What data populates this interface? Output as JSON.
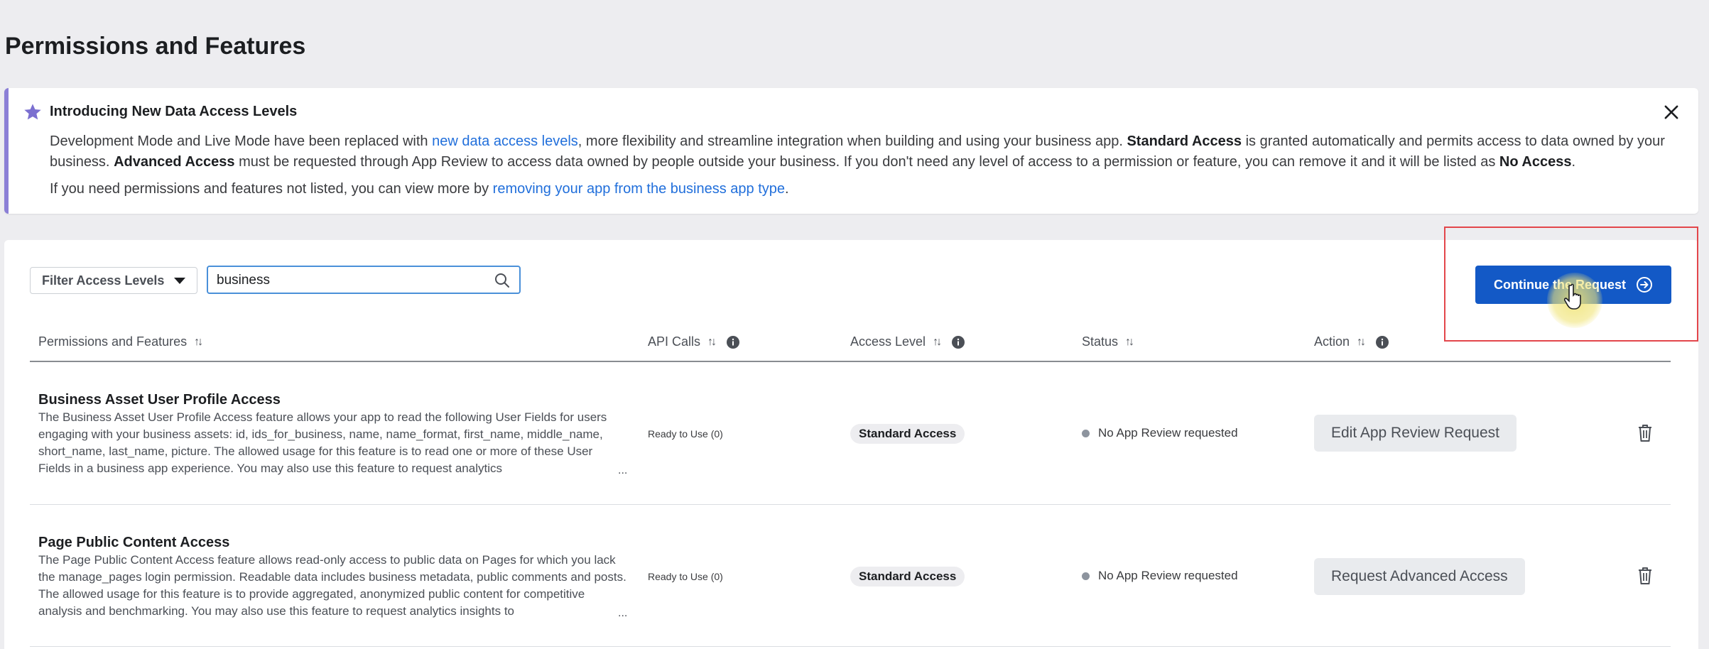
{
  "page": {
    "title": "Permissions and Features"
  },
  "banner": {
    "title": "Introducing New Data Access Levels",
    "p1_a": "Development Mode and Live Mode have been replaced with ",
    "p1_link": "new data access levels",
    "p1_b": ", more flexibility and streamline integration when building and using your business app. ",
    "p1_bold1": "Standard Access",
    "p1_c": " is granted automatically and permits access to data owned by your business. ",
    "p1_bold2": "Advanced Access",
    "p1_d": " must be requested through App Review to access data owned by people outside your business. If you don't need any level of access to a permission or feature, you can remove it and it will be listed as ",
    "p1_bold3": "No Access",
    "p1_e": ".",
    "p2_a": "If you need permissions and features not listed, you can view more by ",
    "p2_link": "removing your app from the business app type",
    "p2_b": "."
  },
  "toolbar": {
    "filter_label": "Filter Access Levels",
    "search_value": "business",
    "continue_label": "Continue the Request"
  },
  "table": {
    "headers": {
      "permissions": "Permissions and Features",
      "api_calls": "API Calls",
      "access_level": "Access Level",
      "status": "Status",
      "action": "Action"
    },
    "rows": [
      {
        "title": "Business Asset User Profile Access",
        "description": "The Business Asset User Profile Access feature allows your app to read the following User Fields for users engaging with your business assets: id, ids_for_business, name, name_format, first_name, middle_name, short_name, last_name, picture. The allowed usage for this feature is to read one or more of these User Fields in a business app experience. You may also use this feature to request analytics",
        "api_calls": "Ready to Use (0)",
        "access_level": "Standard Access",
        "status": "No App Review requested",
        "action": "Edit App Review Request"
      },
      {
        "title": "Page Public Content Access",
        "description": "The Page Public Content Access feature allows read-only access to public data on Pages for which you lack the manage_pages login permission. Readable data includes business metadata, public comments and posts. The allowed usage for this feature is to provide aggregated, anonymized public content for competitive analysis and benchmarking. You may also use this feature to request analytics insights to",
        "api_calls": "Ready to Use (0)",
        "access_level": "Standard Access",
        "status": "No App Review requested",
        "action": "Request Advanced Access"
      }
    ],
    "ellipsis": "..."
  },
  "colors": {
    "primary": "#1359c6",
    "link": "#216fdb",
    "banner_accent": "#8b7fd6",
    "highlight_border": "#e3464b"
  }
}
